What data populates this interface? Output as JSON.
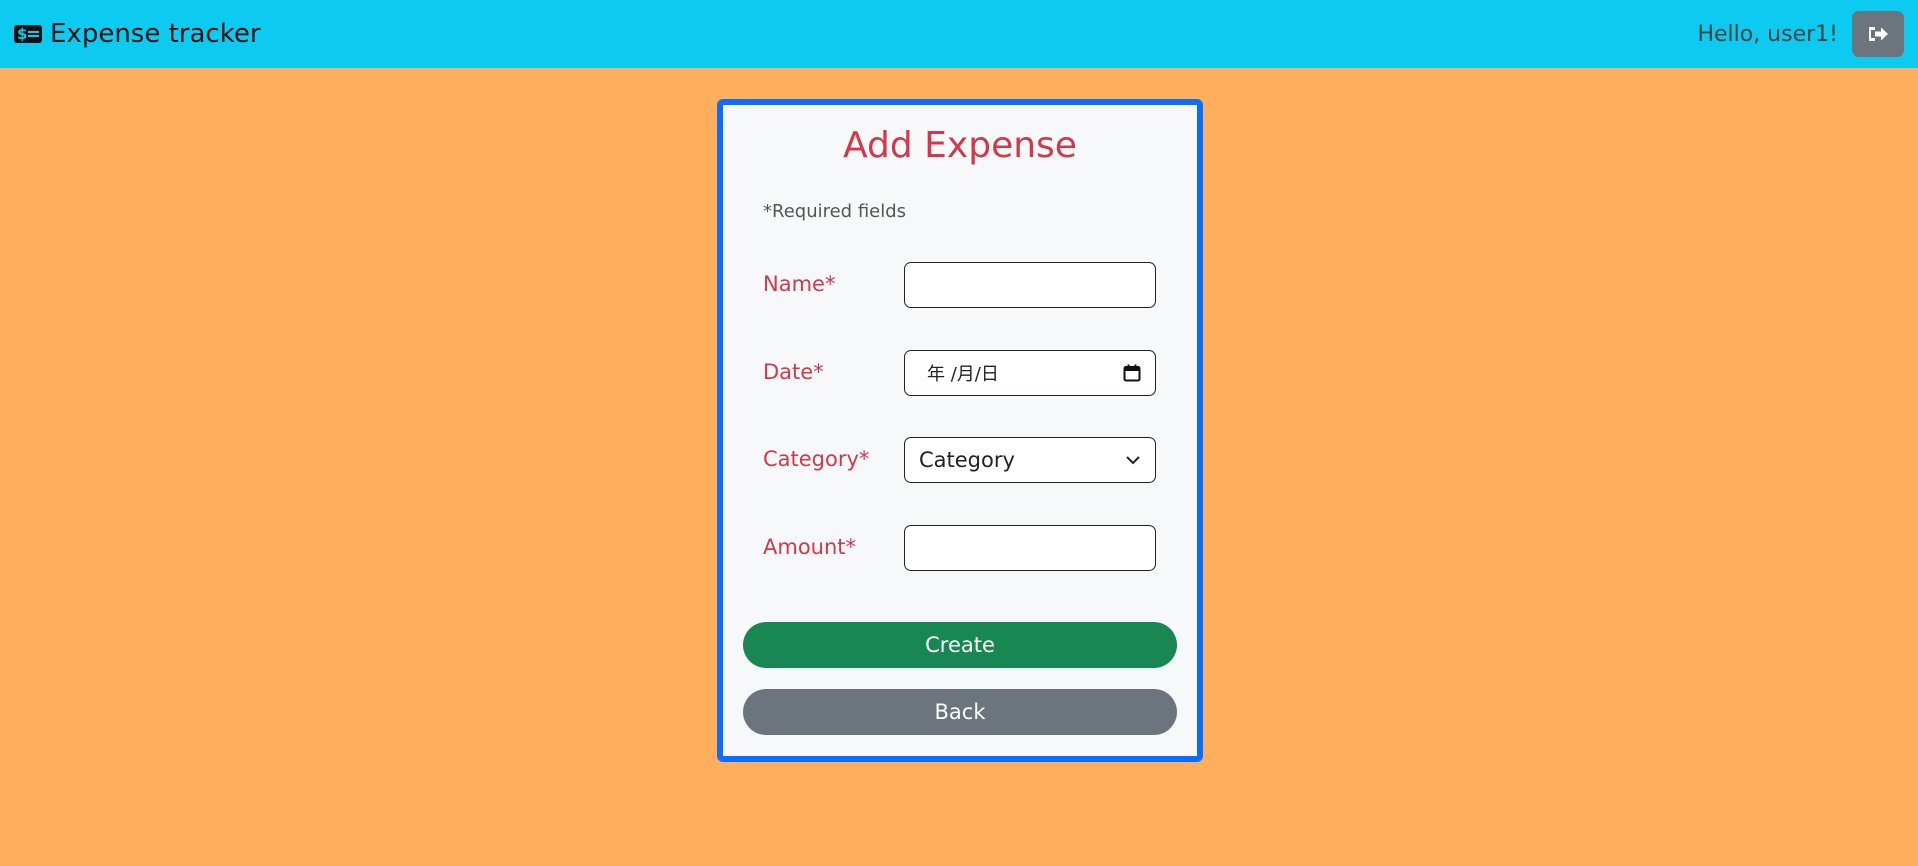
{
  "navbar": {
    "brand_title": "Expense tracker",
    "brand_icon": "money-bill-icon",
    "greeting": "Hello, user1!",
    "logout_icon": "sign-out-icon"
  },
  "form": {
    "title": "Add Expense",
    "required_note": "*Required fields",
    "fields": {
      "name": {
        "label": "Name*",
        "value": ""
      },
      "date": {
        "label": "Date*",
        "placeholder": "年 /月/日",
        "icon": "calendar-icon"
      },
      "category": {
        "label": "Category*",
        "selected": "Category",
        "icon": "chevron-down-icon"
      },
      "amount": {
        "label": "Amount*",
        "value": ""
      }
    },
    "buttons": {
      "create": "Create",
      "back": "Back"
    }
  },
  "colors": {
    "page_background": "#ffae5e",
    "navbar_background": "#0dcaf0",
    "card_border": "#0d6efd",
    "label_color": "#d1394a",
    "create_button": "#198754",
    "back_button": "#6c757d"
  }
}
